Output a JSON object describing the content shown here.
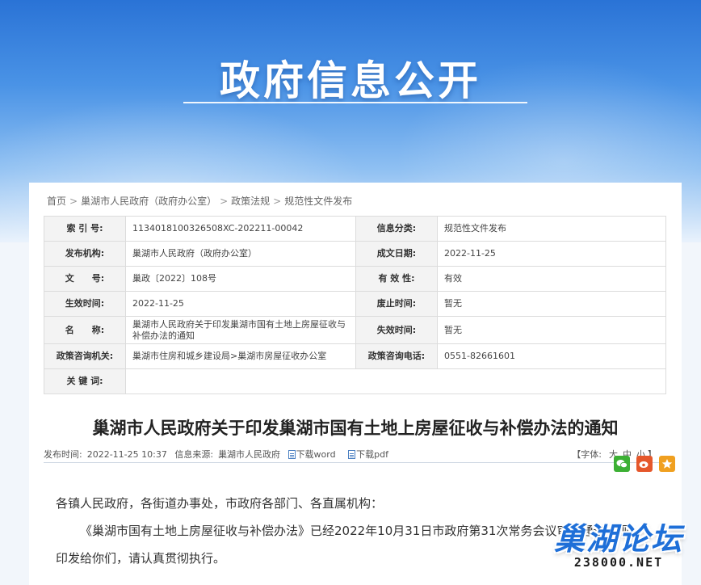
{
  "banner": {
    "title": "政府信息公开"
  },
  "breadcrumb": [
    "首页",
    "巢湖市人民政府（政府办公室）",
    "政策法规",
    "规范性文件发布"
  ],
  "meta": {
    "index_label": "索 引 号:",
    "index_value": "1134018100326508XC-202211-00042",
    "category_label": "信息分类:",
    "category_value": "规范性文件发布",
    "publisher_label": "发布机构:",
    "publisher_value": "巢湖市人民政府（政府办公室）",
    "created_label": "成文日期:",
    "created_value": "2022-11-25",
    "docno_label": "文　　号:",
    "docno_value": "巢政〔2022〕108号",
    "validity_label": "有 效 性:",
    "validity_value": "有效",
    "effective_label": "生效时间:",
    "effective_value": "2022-11-25",
    "abolish_label": "废止时间:",
    "abolish_value": "暂无",
    "name_label": "名　　称:",
    "name_value": "巢湖市人民政府关于印发巢湖市国有土地上房屋征收与补偿办法的通知",
    "expire_label": "失效时间:",
    "expire_value": "暂无",
    "consult_org_label": "政策咨询机关:",
    "consult_org_value": "巢湖市住房和城乡建设局>巢湖市房屋征收办公室",
    "consult_phone_label": "政策咨询电话:",
    "consult_phone_value": "0551-82661601",
    "keywords_label": "关 键 词:",
    "keywords_value": ""
  },
  "document": {
    "title": "巢湖市人民政府关于印发巢湖市国有土地上房屋征收与补偿办法的通知",
    "publish_time_label": "发布时间:",
    "publish_time": "2022-11-25 10:37",
    "source_label": "信息来源:",
    "source": "巢湖市人民政府",
    "download_word": "下载word",
    "download_pdf": "下载pdf",
    "fontsize_prefix": "【字体:",
    "fontsize_large": "大",
    "fontsize_medium": "中",
    "fontsize_small": "小",
    "fontsize_suffix": "】",
    "salutation": "各镇人民政府，各街道办事处，市政府各部门、各直属机构：",
    "paragraph1_line1": "《巢湖市国有土地上房屋征收与补偿办法》已经2022年10月31日市政府第31次常务会议审议通过，现",
    "paragraph1_line2": "印发给你们，请认真贯彻执行。"
  },
  "share": {
    "wechat_icon": "wechat-icon",
    "weibo_icon": "weibo-icon",
    "favorite_icon": "star-icon"
  },
  "watermark": {
    "cn": "巢湖论坛",
    "en": "238000.NET"
  },
  "colors": {
    "banner_blue": "#2a73d6",
    "title_text": "#222222",
    "watermark_blue": "#1e6fd8"
  }
}
